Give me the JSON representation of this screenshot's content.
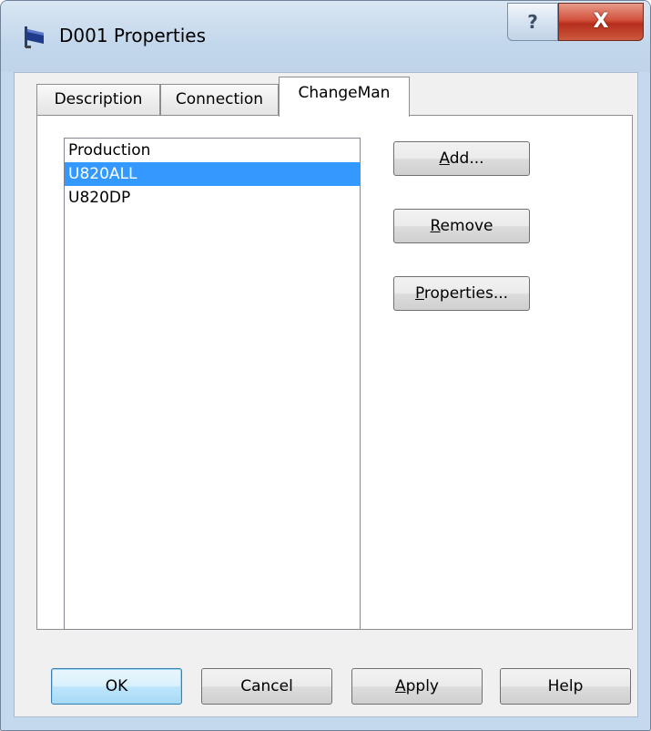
{
  "window": {
    "title": "D001 Properties",
    "help_glyph": "?",
    "close_glyph": "X"
  },
  "tabs": [
    {
      "label": "Description",
      "active": false
    },
    {
      "label": "Connection",
      "active": false
    },
    {
      "label": "ChangeMan",
      "active": true
    }
  ],
  "list": {
    "items": [
      "Production",
      "U820ALL",
      "U820DP"
    ],
    "selected": "U820ALL"
  },
  "side_buttons": {
    "add": {
      "accel": "A",
      "rest": "dd..."
    },
    "remove": {
      "accel": "R",
      "rest": "emove"
    },
    "properties": {
      "accel": "P",
      "rest": "roperties..."
    }
  },
  "footer_buttons": {
    "ok": "OK",
    "cancel": "Cancel",
    "apply": {
      "accel": "A",
      "rest": "pply"
    },
    "help": "Help"
  },
  "colors": {
    "selection": "#3399ff",
    "titlebar": "#c4d9ee",
    "close_button": "#c8402a"
  }
}
